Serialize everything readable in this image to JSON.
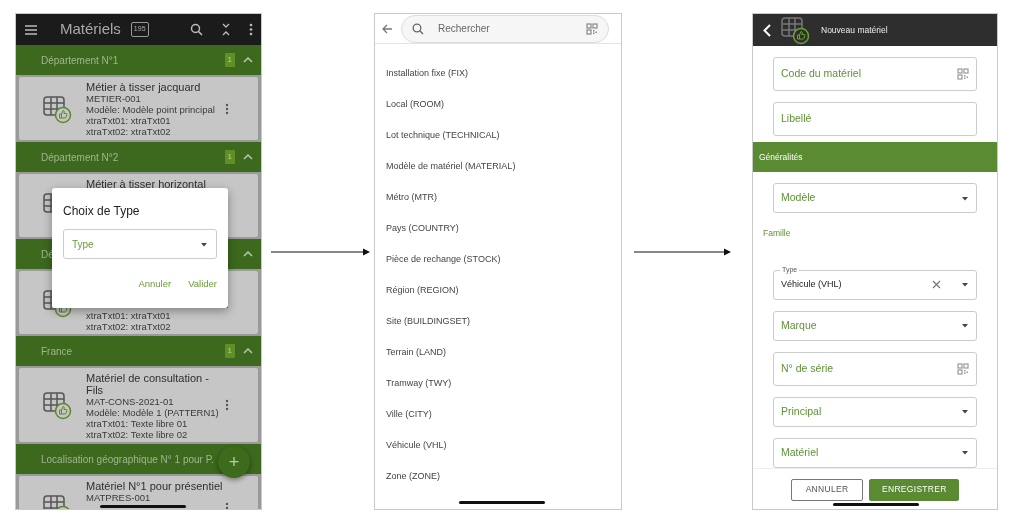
{
  "list_screen": {
    "title": "Matériels",
    "count": "195",
    "groups": [
      {
        "title": "Département N°1",
        "count": "1",
        "expanded": true,
        "items": [
          {
            "title": "Métier à tisser jacquard",
            "lines": [
              "METIER-001",
              "Modèle: Modèle point principal",
              "xtraTxt01: xtraTxt01",
              "xtraTxt02: xtraTxt02"
            ]
          }
        ]
      },
      {
        "title": "Département N°2",
        "count": "1",
        "expanded": true,
        "items": [
          {
            "title": "Métier à tisser horizontal"
          }
        ]
      },
      {
        "title": "Dé",
        "expanded": true,
        "items": [
          {
            "lines": [
              "xtraTxt01: xtraTxt01",
              "xtraTxt02: xtraTxt02"
            ]
          }
        ]
      },
      {
        "title": "France",
        "count": "1",
        "expanded": true,
        "items": [
          {
            "title": "Matériel de consultation - Fils",
            "lines": [
              "MAT-CONS-2021-01",
              "Modèle: Modèle 1 (PATTERN1)",
              "xtraTxt01: Texte libre 01",
              "xtraTxt02: Texte libre 02"
            ]
          }
        ]
      },
      {
        "title": "Localisation géographique N° 1 pour P.",
        "items": [
          {
            "title": "Matériel N°1 pour présentiel",
            "lines": [
              "MATPRES-001"
            ]
          }
        ]
      }
    ],
    "dialog": {
      "title": "Choix de Type",
      "field": {
        "placeholder": "Type"
      },
      "buttons": [
        "Annuler",
        "Valider"
      ]
    },
    "fab": "+"
  },
  "type_picker": {
    "search": {
      "placeholder": "Rechercher"
    },
    "options": [
      "Installation fixe (FIX)",
      "Local (ROOM)",
      "Lot technique (TECHNICAL)",
      "Modèle de matériel (MATERIAL)",
      "Métro (MTR)",
      "Pays (COUNTRY)",
      "Pièce de rechange (STOCK)",
      "Région (REGION)",
      "Site (BUILDINGSET)",
      "Terrain (LAND)",
      "Tramway (TWY)",
      "Ville (CITY)",
      "Véhicule (VHL)",
      "Zone (ZONE)"
    ]
  },
  "form_screen": {
    "title": "Nouveau matériel",
    "fields": [
      {
        "kind": "scan",
        "label": "Code du matériel"
      },
      {
        "kind": "text",
        "label": "Libellé"
      },
      {
        "kind": "section",
        "label": "Généralités"
      },
      {
        "kind": "select",
        "label": "Modèle"
      },
      {
        "kind": "caption",
        "label": "Famille"
      },
      {
        "kind": "filled-select",
        "label": "Type",
        "value": "Véhicule (VHL)"
      },
      {
        "kind": "select",
        "label": "Marque"
      },
      {
        "kind": "scan",
        "label": "N° de série"
      },
      {
        "kind": "select",
        "label": "Principal"
      },
      {
        "kind": "select",
        "label": "Matériel"
      }
    ],
    "buttons": [
      {
        "kind": "outline",
        "label": "ANNULER"
      },
      {
        "kind": "primary",
        "label": "ENREGISTRER"
      }
    ]
  }
}
